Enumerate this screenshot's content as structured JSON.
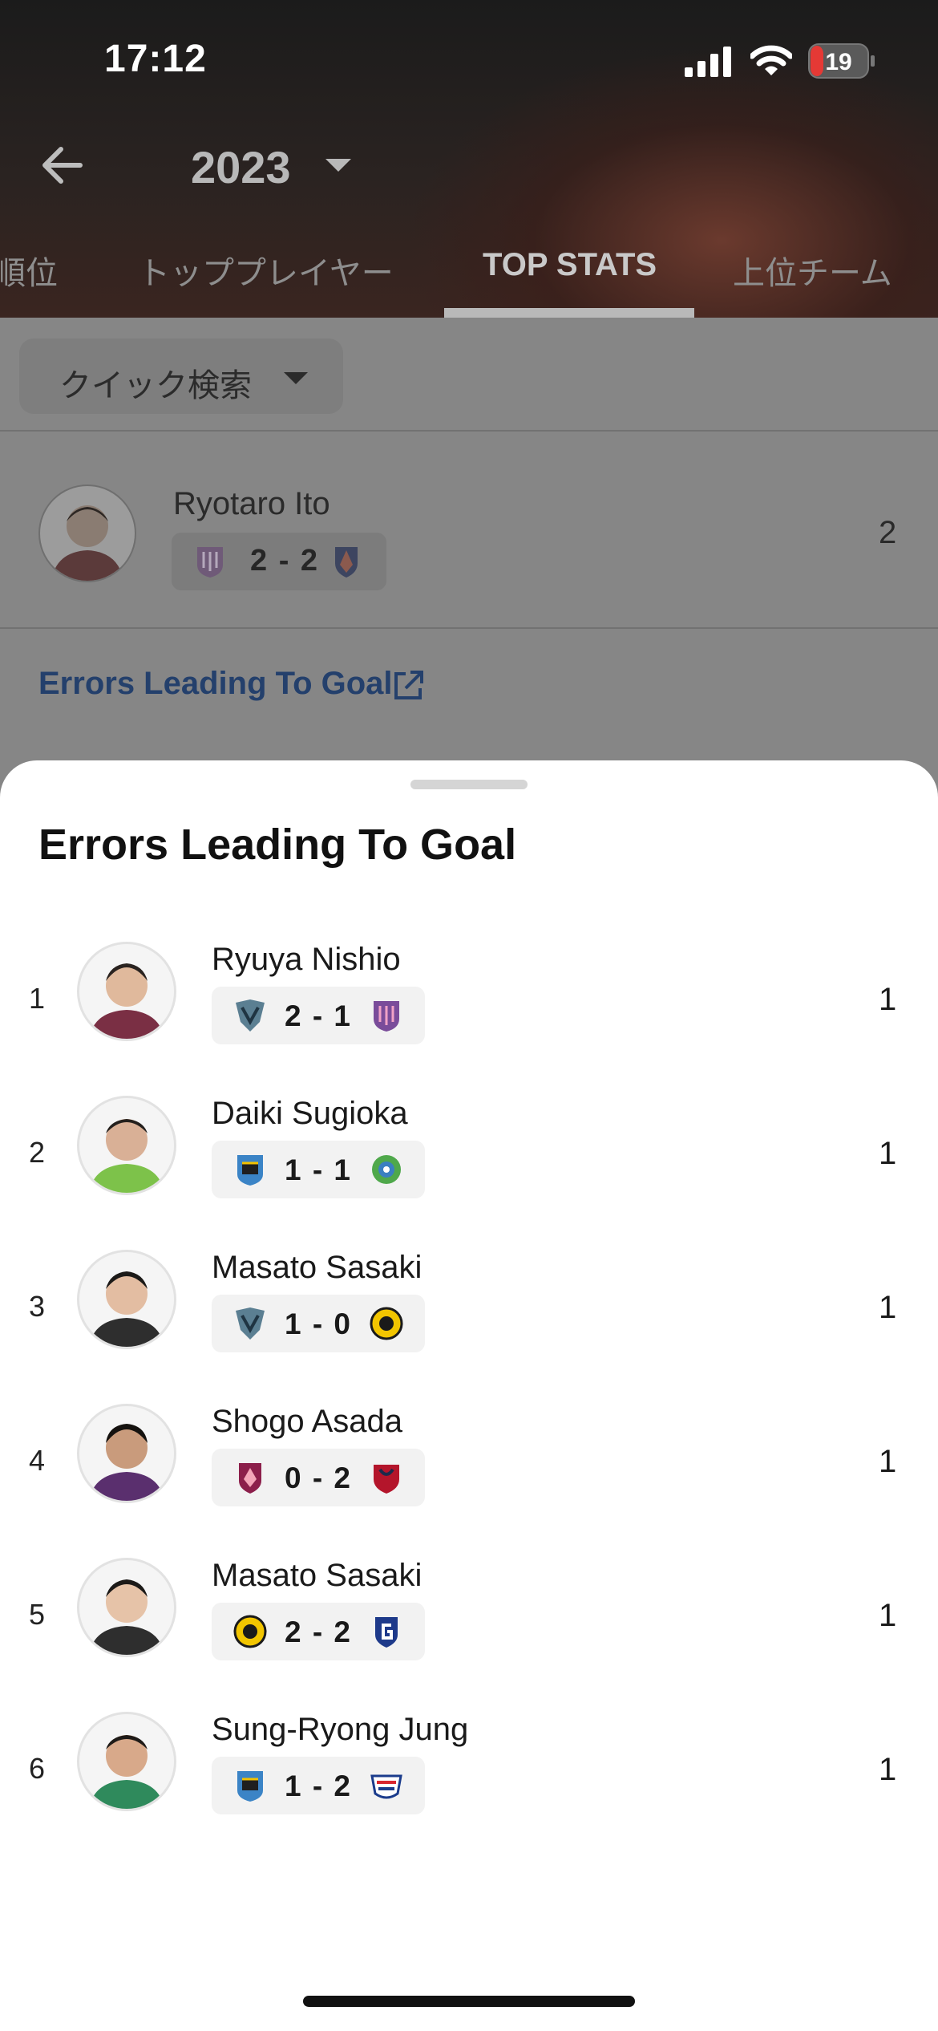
{
  "status_bar": {
    "time": "17:12",
    "battery": "19"
  },
  "header": {
    "year": "2023"
  },
  "tabs": [
    {
      "label": "順位"
    },
    {
      "label": "トッププレイヤー"
    },
    {
      "label": "TOP STATS"
    },
    {
      "label": "上位チーム"
    }
  ],
  "quick_search": {
    "label": "クイック検索"
  },
  "background_row": {
    "name": "Ryotaro Ito",
    "score": "2 - 2",
    "value": "2"
  },
  "background_link": {
    "label": "Errors Leading To Goal"
  },
  "sheet": {
    "title": "Errors Leading To Goal",
    "rows": [
      {
        "rank": "1",
        "name": "Ryuya Nishio",
        "score": "2 - 1",
        "value": "1",
        "home_crest": "avispa-crest",
        "away_crest": "cerezo-crest"
      },
      {
        "rank": "2",
        "name": "Daiki Sugioka",
        "score": "1 - 1",
        "value": "1",
        "home_crest": "frontale-crest",
        "away_crest": "bellmare-crest"
      },
      {
        "rank": "3",
        "name": "Masato Sasaki",
        "score": "1 - 0",
        "value": "1",
        "home_crest": "avispa-crest",
        "away_crest": "reysol-crest"
      },
      {
        "rank": "4",
        "name": "Shogo Asada",
        "score": "0 - 2",
        "value": "1",
        "home_crest": "sanga-crest",
        "away_crest": "antlers-crest"
      },
      {
        "rank": "5",
        "name": "Masato Sasaki",
        "score": "2 - 2",
        "value": "1",
        "home_crest": "reysol-crest",
        "away_crest": "gamba-crest"
      },
      {
        "rank": "6",
        "name": "Sung-Ryong Jung",
        "score": "1 - 2",
        "value": "1",
        "home_crest": "frontale-crest",
        "away_crest": "marinos-crest"
      }
    ]
  },
  "colors": {
    "link": "#24406c",
    "sheet_bg": "#ffffff",
    "dim_overlay": "#868686"
  }
}
